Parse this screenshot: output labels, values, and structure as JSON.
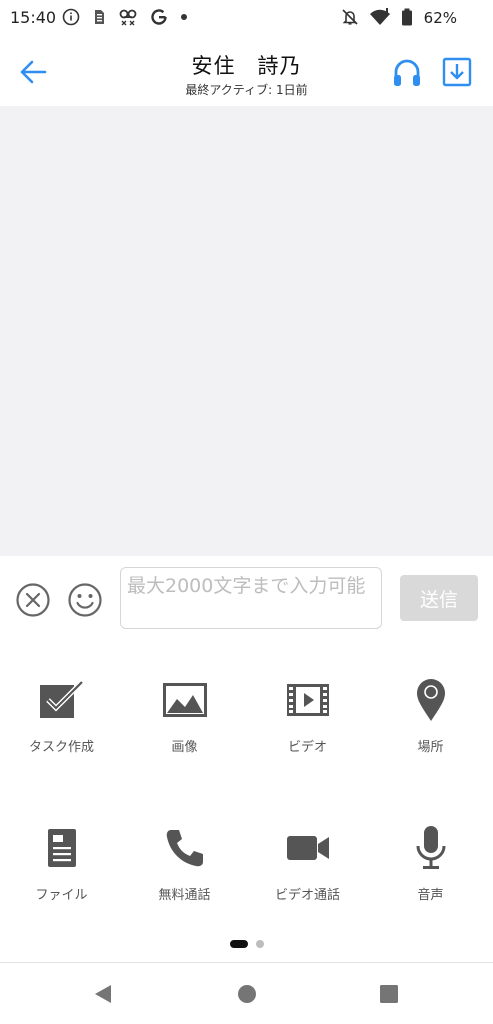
{
  "status_bar": {
    "time": "15:40",
    "battery": "62%",
    "left_icons": [
      "info-icon",
      "sim-icon",
      "voicemail-icon",
      "google-icon",
      "dot-icon"
    ],
    "right_icons": [
      "mute-bell-icon",
      "wifi-icon",
      "battery-icon"
    ]
  },
  "header": {
    "title": "安住　詩乃",
    "subtitle": "最終アクティブ: 1日前",
    "accent_color": "#2f8ff0"
  },
  "composer": {
    "placeholder": "最大2000文字まで入力可能",
    "send_label": "送信"
  },
  "grid": {
    "items": [
      {
        "label": "タスク作成",
        "icon": "task-check-icon"
      },
      {
        "label": "画像",
        "icon": "image-icon"
      },
      {
        "label": "ビデオ",
        "icon": "video-film-icon"
      },
      {
        "label": "場所",
        "icon": "location-pin-icon"
      },
      {
        "label": "ファイル",
        "icon": "file-icon"
      },
      {
        "label": "無料通話",
        "icon": "phone-icon"
      },
      {
        "label": "ビデオ通話",
        "icon": "video-camera-icon"
      },
      {
        "label": "音声",
        "icon": "microphone-icon"
      }
    ]
  },
  "nav": {
    "icons": [
      "back-triangle-icon",
      "home-circle-icon",
      "recents-square-icon"
    ]
  }
}
